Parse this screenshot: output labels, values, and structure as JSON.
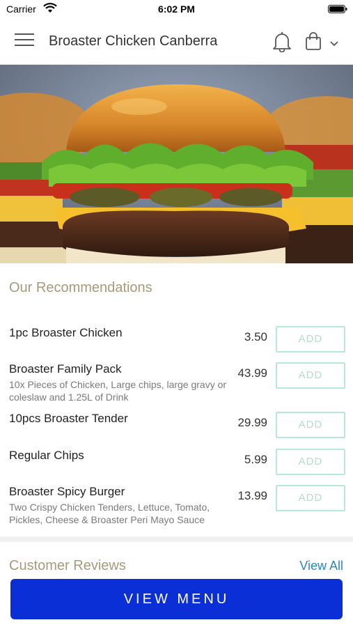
{
  "status_bar": {
    "carrier": "Carrier",
    "time": "6:02 PM"
  },
  "header": {
    "title": "Broaster Chicken Canberra"
  },
  "recommendations": {
    "title": "Our Recommendations",
    "items": [
      {
        "name": "1pc Broaster Chicken",
        "description": "",
        "price": "3.50",
        "add_label": "ADD"
      },
      {
        "name": "Broaster Family Pack",
        "description": "10x Pieces of Chicken, Large chips, large gravy or coleslaw and 1.25L of Drink",
        "price": "43.99",
        "add_label": "ADD"
      },
      {
        "name": "10pcs Broaster Tender",
        "description": "",
        "price": "29.99",
        "add_label": "ADD"
      },
      {
        "name": "Regular Chips",
        "description": "",
        "price": "5.99",
        "add_label": "ADD"
      },
      {
        "name": "Broaster Spicy Burger",
        "description": "Two Crispy Chicken Tenders, Lettuce, Tomato, Pickles, Cheese & Broaster Peri Mayo Sauce",
        "price": "13.99",
        "add_label": "ADD"
      }
    ]
  },
  "reviews": {
    "title": "Customer Reviews",
    "view_all_label": "View All"
  },
  "footer": {
    "view_menu_label": "VIEW MENU"
  },
  "colors": {
    "accent_title": "#a69a7c",
    "primary_button": "#0a2fd6",
    "link": "#2a86c4",
    "add_border": "#b9e7d6"
  },
  "icons": [
    "wifi-icon",
    "battery-icon",
    "hamburger-menu-icon",
    "bell-icon",
    "shopping-bag-icon",
    "chevron-down-icon"
  ]
}
